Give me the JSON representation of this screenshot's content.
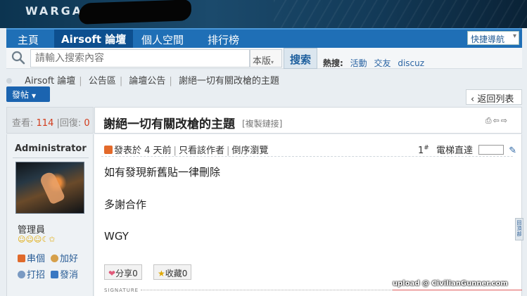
{
  "banner": {
    "logo_text": "WARGA"
  },
  "nav": {
    "tabs": [
      {
        "label": "主頁"
      },
      {
        "label": "Airsoft 論壇",
        "active": true
      },
      {
        "label": "個人空間"
      },
      {
        "label": "排行榜"
      }
    ],
    "quick_nav": "快捷導航"
  },
  "search": {
    "placeholder": "請輸入搜索內容",
    "scope": "本版",
    "button": "搜索",
    "hot_label": "熱搜:",
    "hot_items": [
      "活動",
      "交友",
      "discuz"
    ]
  },
  "breadcrumb": [
    "Airsoft 論壇",
    "公告區",
    "論壇公告",
    "謝絕一切有關改槍的主題"
  ],
  "post_button": "發帖",
  "back_button": "返回列表",
  "stats": {
    "views_label": "查看:",
    "views": "114",
    "sep": "|",
    "replies_label": "回復:",
    "replies": "0"
  },
  "thread": {
    "title": "謝絕一切有關改槍的主題",
    "copy_link": "[複製鏈接]"
  },
  "author": {
    "name": "Administrator",
    "group": "管理員",
    "stars": "☺☺☺☾✩",
    "actions": [
      "串個",
      "加好",
      "打招",
      "發消"
    ]
  },
  "post": {
    "meta": {
      "posted": "發表於 4 天前",
      "only_author": "只看該作者",
      "reverse": "倒序瀏覽"
    },
    "floor": "1",
    "floor_mark": "#",
    "jump_label": "電梯直達",
    "body": [
      "如有發現新舊貼一律刪除",
      "多謝合作",
      "WGY"
    ],
    "share": {
      "label": "分享",
      "count": "0"
    },
    "favorite": {
      "label": "收藏",
      "count": "0"
    },
    "signature_label": "SIGNATURE"
  },
  "side_tool": "回頂部",
  "watermark": "upload @ CivilianGunner.com",
  "colors": {
    "nav_blue": "#1f6fb6",
    "accent_red": "#d23c1c",
    "link_blue": "#2a64a3"
  }
}
